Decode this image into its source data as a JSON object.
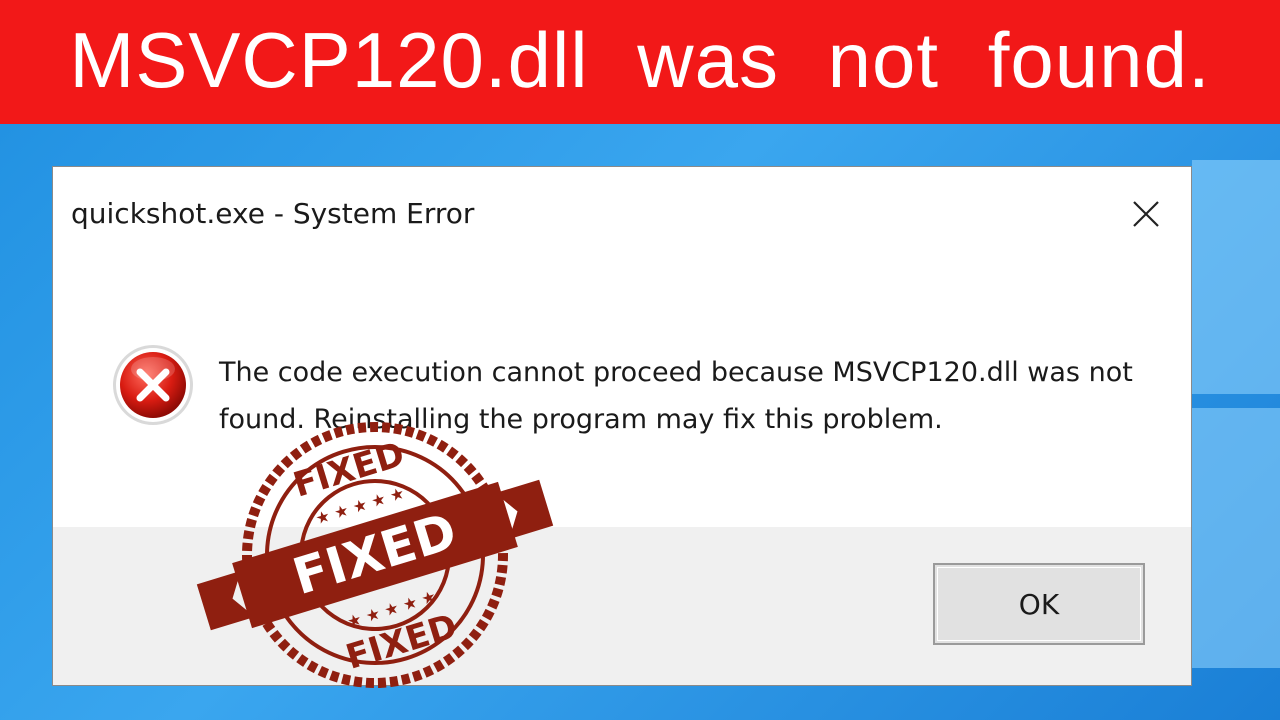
{
  "banner": {
    "text": "MSVCP120.dll  was  not  found."
  },
  "dialog": {
    "title": "quickshot.exe - System Error",
    "message": "The code execution cannot proceed because MSVCP120.dll was not found. Reinstalling the program may fix this problem.",
    "ok_label": "OK",
    "icon": "error-x-icon",
    "close_icon": "close-icon"
  },
  "stamp": {
    "text_top": "FIXED",
    "text_ribbon": "FIXED",
    "text_bottom": "FIXED",
    "color": "#8f1f10"
  },
  "colors": {
    "banner": "#f21818",
    "desktop": "#1f8fe0",
    "dialog_footer": "#f0f0f0"
  }
}
